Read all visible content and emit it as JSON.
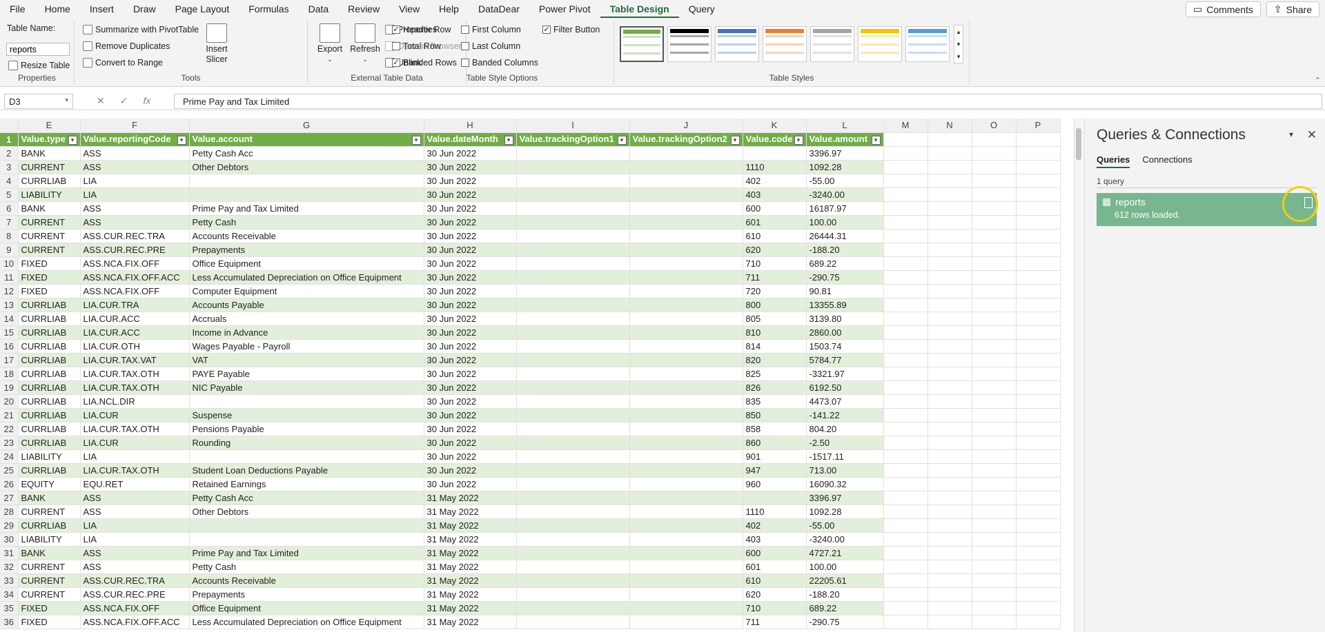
{
  "ribbon_tabs": [
    "File",
    "Home",
    "Insert",
    "Draw",
    "Page Layout",
    "Formulas",
    "Data",
    "Review",
    "View",
    "Help",
    "DataDear",
    "Power Pivot",
    "Table Design",
    "Query"
  ],
  "active_tab": "Table Design",
  "comments_label": "Comments",
  "share_label": "Share",
  "properties": {
    "table_name_label": "Table Name:",
    "table_name_value": "reports",
    "resize": "Resize Table",
    "group": "Properties"
  },
  "tools": {
    "summarize": "Summarize with PivotTable",
    "remove_dup": "Remove Duplicates",
    "convert": "Convert to Range",
    "insert_slicer": "Insert\nSlicer",
    "group": "Tools"
  },
  "external": {
    "export": "Export",
    "refresh": "Refresh",
    "properties": "Properties",
    "open_browser": "Open in Browser",
    "unlink": "Unlink",
    "group": "External Table Data"
  },
  "style_options": {
    "header_row": "Header Row",
    "total_row": "Total Row",
    "banded_rows": "Banded Rows",
    "first_column": "First Column",
    "last_column": "Last Column",
    "banded_columns": "Banded Columns",
    "filter_button": "Filter Button",
    "group": "Table Style Options",
    "checked": [
      "Header Row",
      "Banded Rows",
      "Filter Button"
    ]
  },
  "table_styles": {
    "group": "Table Styles",
    "swatches": [
      "#70ad47",
      "#000000",
      "#4472c4",
      "#ed7d31",
      "#a5a5a5",
      "#ffc000",
      "#5b9bd5"
    ]
  },
  "name_box": "D3",
  "formula": "Prime Pay and Tax Limited",
  "columns": [
    "E",
    "F",
    "G",
    "H",
    "I",
    "J",
    "K",
    "L",
    "M",
    "N",
    "O",
    "P"
  ],
  "headers": [
    "Value.type",
    "Value.reportingCode",
    "Value.account",
    "Value.dateMonth",
    "Value.trackingOption1",
    "Value.trackingOption2",
    "Value.code",
    "Value.amount"
  ],
  "rows": [
    [
      "BANK",
      "ASS",
      "Petty Cash Acc",
      "30 Jun 2022",
      "",
      "",
      "",
      "3396.97"
    ],
    [
      "CURRENT",
      "ASS",
      "Other Debtors",
      "30 Jun 2022",
      "",
      "",
      "1110",
      "1092.28"
    ],
    [
      "CURRLIAB",
      "LIA",
      "",
      "30 Jun 2022",
      "",
      "",
      "402",
      "-55.00"
    ],
    [
      "LIABILITY",
      "LIA",
      "",
      "30 Jun 2022",
      "",
      "",
      "403",
      "-3240.00"
    ],
    [
      "BANK",
      "ASS",
      "Prime Pay and Tax Limited",
      "30 Jun 2022",
      "",
      "",
      "600",
      "16187.97"
    ],
    [
      "CURRENT",
      "ASS",
      "Petty Cash",
      "30 Jun 2022",
      "",
      "",
      "601",
      "100.00"
    ],
    [
      "CURRENT",
      "ASS.CUR.REC.TRA",
      "Accounts Receivable",
      "30 Jun 2022",
      "",
      "",
      "610",
      "26444.31"
    ],
    [
      "CURRENT",
      "ASS.CUR.REC.PRE",
      "Prepayments",
      "30 Jun 2022",
      "",
      "",
      "620",
      "-188.20"
    ],
    [
      "FIXED",
      "ASS.NCA.FIX.OFF",
      "Office Equipment",
      "30 Jun 2022",
      "",
      "",
      "710",
      "689.22"
    ],
    [
      "FIXED",
      "ASS.NCA.FIX.OFF.ACC",
      "Less Accumulated Depreciation on Office Equipment",
      "30 Jun 2022",
      "",
      "",
      "711",
      "-290.75"
    ],
    [
      "FIXED",
      "ASS.NCA.FIX.OFF",
      "Computer Equipment",
      "30 Jun 2022",
      "",
      "",
      "720",
      "90.81"
    ],
    [
      "CURRLIAB",
      "LIA.CUR.TRA",
      "Accounts Payable",
      "30 Jun 2022",
      "",
      "",
      "800",
      "13355.89"
    ],
    [
      "CURRLIAB",
      "LIA.CUR.ACC",
      "Accruals",
      "30 Jun 2022",
      "",
      "",
      "805",
      "3139.80"
    ],
    [
      "CURRLIAB",
      "LIA.CUR.ACC",
      "Income in Advance",
      "30 Jun 2022",
      "",
      "",
      "810",
      "2860.00"
    ],
    [
      "CURRLIAB",
      "LIA.CUR.OTH",
      "Wages Payable - Payroll",
      "30 Jun 2022",
      "",
      "",
      "814",
      "1503.74"
    ],
    [
      "CURRLIAB",
      "LIA.CUR.TAX.VAT",
      "VAT",
      "30 Jun 2022",
      "",
      "",
      "820",
      "5784.77"
    ],
    [
      "CURRLIAB",
      "LIA.CUR.TAX.OTH",
      "PAYE Payable",
      "30 Jun 2022",
      "",
      "",
      "825",
      "-3321.97"
    ],
    [
      "CURRLIAB",
      "LIA.CUR.TAX.OTH",
      "NIC Payable",
      "30 Jun 2022",
      "",
      "",
      "826",
      "6192.50"
    ],
    [
      "CURRLIAB",
      "LIA.NCL.DIR",
      "",
      "30 Jun 2022",
      "",
      "",
      "835",
      "4473.07"
    ],
    [
      "CURRLIAB",
      "LIA.CUR",
      "Suspense",
      "30 Jun 2022",
      "",
      "",
      "850",
      "-141.22"
    ],
    [
      "CURRLIAB",
      "LIA.CUR.TAX.OTH",
      "Pensions Payable",
      "30 Jun 2022",
      "",
      "",
      "858",
      "804.20"
    ],
    [
      "CURRLIAB",
      "LIA.CUR",
      "Rounding",
      "30 Jun 2022",
      "",
      "",
      "860",
      "-2.50"
    ],
    [
      "LIABILITY",
      "LIA",
      "",
      "30 Jun 2022",
      "",
      "",
      "901",
      "-1517.11"
    ],
    [
      "CURRLIAB",
      "LIA.CUR.TAX.OTH",
      "Student Loan Deductions Payable",
      "30 Jun 2022",
      "",
      "",
      "947",
      "713.00"
    ],
    [
      "EQUITY",
      "EQU.RET",
      "Retained Earnings",
      "30 Jun 2022",
      "",
      "",
      "960",
      "16090.32"
    ],
    [
      "BANK",
      "ASS",
      "Petty Cash Acc",
      "31 May 2022",
      "",
      "",
      "",
      "3396.97"
    ],
    [
      "CURRENT",
      "ASS",
      "Other Debtors",
      "31 May 2022",
      "",
      "",
      "1110",
      "1092.28"
    ],
    [
      "CURRLIAB",
      "LIA",
      "",
      "31 May 2022",
      "",
      "",
      "402",
      "-55.00"
    ],
    [
      "LIABILITY",
      "LIA",
      "",
      "31 May 2022",
      "",
      "",
      "403",
      "-3240.00"
    ],
    [
      "BANK",
      "ASS",
      "Prime Pay and Tax Limited",
      "31 May 2022",
      "",
      "",
      "600",
      "4727.21"
    ],
    [
      "CURRENT",
      "ASS",
      "Petty Cash",
      "31 May 2022",
      "",
      "",
      "601",
      "100.00"
    ],
    [
      "CURRENT",
      "ASS.CUR.REC.TRA",
      "Accounts Receivable",
      "31 May 2022",
      "",
      "",
      "610",
      "22205.61"
    ],
    [
      "CURRENT",
      "ASS.CUR.REC.PRE",
      "Prepayments",
      "31 May 2022",
      "",
      "",
      "620",
      "-188.20"
    ],
    [
      "FIXED",
      "ASS.NCA.FIX.OFF",
      "Office Equipment",
      "31 May 2022",
      "",
      "",
      "710",
      "689.22"
    ],
    [
      "FIXED",
      "ASS.NCA.FIX.OFF.ACC",
      "Less Accumulated Depreciation on Office Equipment",
      "31 May 2022",
      "",
      "",
      "711",
      "-290.75"
    ]
  ],
  "pane": {
    "title": "Queries & Connections",
    "tab_queries": "Queries",
    "tab_connections": "Connections",
    "count": "1 query",
    "query_name": "reports",
    "query_status": "612 rows loaded."
  }
}
